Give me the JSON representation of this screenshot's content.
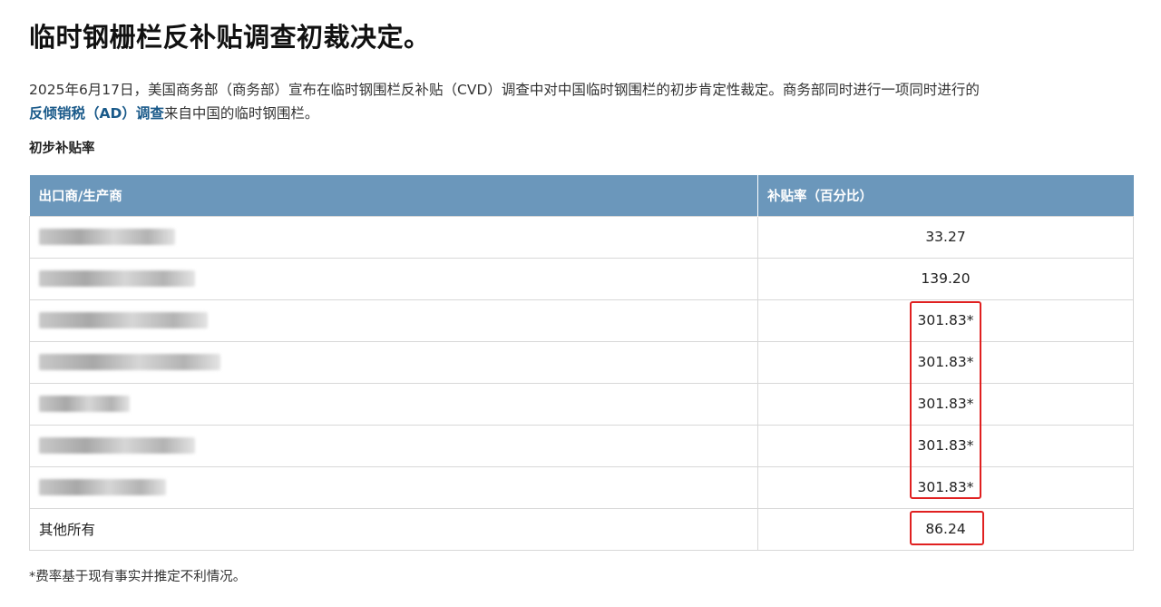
{
  "title": "临时钢栅栏反补贴调查初裁决定。",
  "intro": {
    "text_before": "2025年6月17日，美国商务部（商务部）宣布在临时钢围栏反补贴（CVD）调查中对中国临时钢围栏的初步肯定性裁定。商务部同时进行一项同时进行的",
    "link_text": "反倾销税（AD）调查",
    "text_after": "来自中国的临时钢围栏。"
  },
  "section_heading": "初步补贴率",
  "table": {
    "headers": [
      "出口商/生产商",
      "补贴率（百分比）"
    ],
    "rows": [
      {
        "name": "",
        "rate": "33.27",
        "blurred": true
      },
      {
        "name": "",
        "rate": "139.20",
        "blurred": true
      },
      {
        "name": "",
        "rate": "301.83*",
        "blurred": true
      },
      {
        "name": "",
        "rate": "301.83*",
        "blurred": true
      },
      {
        "name": "",
        "rate": "301.83*",
        "blurred": true
      },
      {
        "name": "",
        "rate": "301.83*",
        "blurred": true
      },
      {
        "name": "",
        "rate": "301.83*",
        "blurred": true
      },
      {
        "name": "其他所有",
        "rate": "86.24",
        "blurred": false
      }
    ]
  },
  "footnote": "*费率基于现有事实并推定不利情况。",
  "colors": {
    "header_bg": "#6b97bb",
    "link": "#1a5a8a",
    "highlight": "#e02020"
  }
}
